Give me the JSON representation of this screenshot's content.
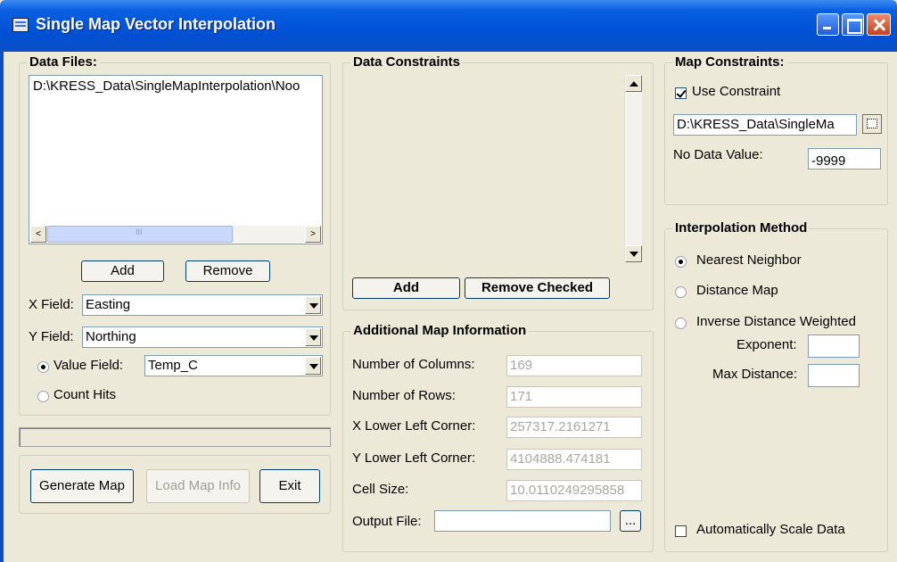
{
  "window": {
    "title": "Single Map Vector Interpolation"
  },
  "data_files": {
    "legend": "Data Files:",
    "items": [
      "D:\\KRESS_Data\\SingleMapInterpolation\\Noo"
    ],
    "scroll_left": "<",
    "scroll_right": ">",
    "scroll_grip": "III",
    "add_label": "Add",
    "remove_label": "Remove",
    "x_field_label": "X Field:",
    "x_field_value": "Easting",
    "y_field_label": "Y Field:",
    "y_field_value": "Northing",
    "value_field_label": "Value Field:",
    "value_field_value": "Temp_C",
    "value_field_selected": true,
    "count_hits_label": "Count Hits",
    "count_hits_selected": false
  },
  "actions": {
    "generate_map_label": "Generate Map",
    "load_map_info_label": "Load Map Info",
    "exit_label": "Exit"
  },
  "data_constraints": {
    "legend": "Data Constraints",
    "add_label": "Add",
    "remove_checked_label": "Remove Checked"
  },
  "additional_map_info": {
    "legend": "Additional Map Information",
    "num_columns_label": "Number of Columns:",
    "num_columns_value": "169",
    "num_rows_label": "Number of Rows:",
    "num_rows_value": "171",
    "x_lower_left_label": "X Lower Left Corner:",
    "x_lower_left_value": "257317.2161271",
    "y_lower_left_label": "Y Lower Left Corner:",
    "y_lower_left_value": "4104888.474181",
    "cell_size_label": "Cell Size:",
    "cell_size_value": "10.0110249295858",
    "output_file_label": "Output File:",
    "output_file_value": "",
    "browse_label": "..."
  },
  "map_constraints": {
    "legend": "Map Constraints:",
    "use_constraint_label": "Use Constraint",
    "use_constraint_checked": true,
    "constraint_path": "D:\\KRESS_Data\\SingleMa",
    "no_data_label": "No Data Value:",
    "no_data_value": "-9999"
  },
  "interpolation": {
    "legend": "Interpolation Method",
    "nearest_neighbor_label": "Nearest Neighbor",
    "distance_map_label": "Distance Map",
    "idw_label": "Inverse Distance Weighted",
    "selected": "Nearest Neighbor",
    "exponent_label": "Exponent:",
    "exponent_value": "",
    "max_distance_label": "Max Distance:",
    "max_distance_value": "",
    "auto_scale_label": "Automatically Scale Data",
    "auto_scale_checked": false
  },
  "colors": {
    "titlebar": "#0051d6",
    "face": "#ece9d8",
    "close_button": "#c4431f"
  }
}
